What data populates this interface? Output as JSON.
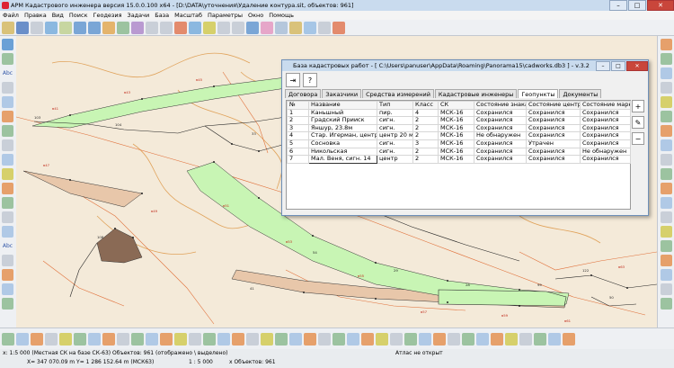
{
  "window": {
    "title": "АРМ Кадастрового инженера версия 15.0.0.100 x64 - [D:\\DATA\\уточнения\\Удаление контура.sit, объектов: 961]",
    "min": "–",
    "max": "□",
    "close": "✕"
  },
  "menu": [
    "Файл",
    "Правка",
    "Вид",
    "Поиск",
    "Геодезия",
    "Задачи",
    "База",
    "Масштаб",
    "Параметры",
    "Окно",
    "Помощь"
  ],
  "left_tool_labels": {
    "abc1": "Abc",
    "abc2": "Abc"
  },
  "dialog": {
    "title": "База кадастровых работ - [ C:\\Users\\panuser\\AppData\\Roaming\\Panorama15\\cadworks.db3 ] - v.3.2",
    "tabs": [
      "Договора",
      "Заказчики",
      "Средства измерений",
      "Кадастровые инженеры",
      "Геопункты",
      "Документы"
    ],
    "active_tab": "Геопункты",
    "columns": [
      "№",
      "Название",
      "Тип",
      "Класс",
      "СК",
      "Состояние знака",
      "Состояние центра",
      "Состояние марки"
    ],
    "rows": [
      [
        "1",
        "Каньшный",
        "пир.",
        "4",
        "МСК-16",
        "Сохранился",
        "Сохранился",
        "Сохранился"
      ],
      [
        "2",
        "Градский Прииск",
        "сигн.",
        "2",
        "МСК-16",
        "Сохранился",
        "Сохранился",
        "Сохранился"
      ],
      [
        "3",
        "Яншур, 23.8м",
        "сигн.",
        "2",
        "МСК-16",
        "Сохранился",
        "Сохранился",
        "Сохранился"
      ],
      [
        "4",
        "Стар. Игерман, центр",
        "центр 20 м",
        "2",
        "МСК-16",
        "Не обнаружен",
        "Сохранился",
        "Сохранился"
      ],
      [
        "5",
        "Сосновка",
        "сигн.",
        "3",
        "МСК-16",
        "Сохранился",
        "Утрачен",
        "Сохранился"
      ],
      [
        "6",
        "Никольская",
        "сигн.",
        "2",
        "МСК-16",
        "Сохранился",
        "Сохранился",
        "Не обнаружен"
      ],
      [
        "7",
        "Мал. Веня, сигн. 14",
        "центр",
        "2",
        "МСК-16",
        "Сохранился",
        "Сохранился",
        "Сохранился"
      ]
    ],
    "side_buttons": [
      "+",
      "✎",
      "−"
    ]
  },
  "status": {
    "line1": "x: 1:5 000 (Местная СК на базе СК-63) Объектов: 961 (отображено \\ выделено)",
    "coords": "X=  347 070.09 m     Y= 1 286 152.64 m  (МСК63)",
    "scale": "1 : 5 000",
    "objects": "x     Объектов: 961",
    "atlas": "Атлас не открыт"
  },
  "colors": {
    "green_fill": "#c8f5b4",
    "brown_fill": "#e8c7aa",
    "dark_fill": "#8a6a55",
    "red_line": "#e0703a",
    "map_bg": "#f4ead9"
  },
  "map_labels": {
    "n1": "в41",
    "n2": "в43",
    "n3": "в45",
    "n4": "в47",
    "n5": "в49",
    "n6": "в51",
    "n7": "в53",
    "n8": "в55",
    "n9": "в57",
    "n10": "в59",
    "n11": "в61",
    "n12": "в63",
    "k1": "103",
    "k2": "104",
    "k3": "33",
    "k4": "54",
    "k5": "29",
    "k6": "28",
    "k7": "99",
    "k8": "41",
    "k9": "108",
    "k10": "122",
    "k11": "50"
  }
}
